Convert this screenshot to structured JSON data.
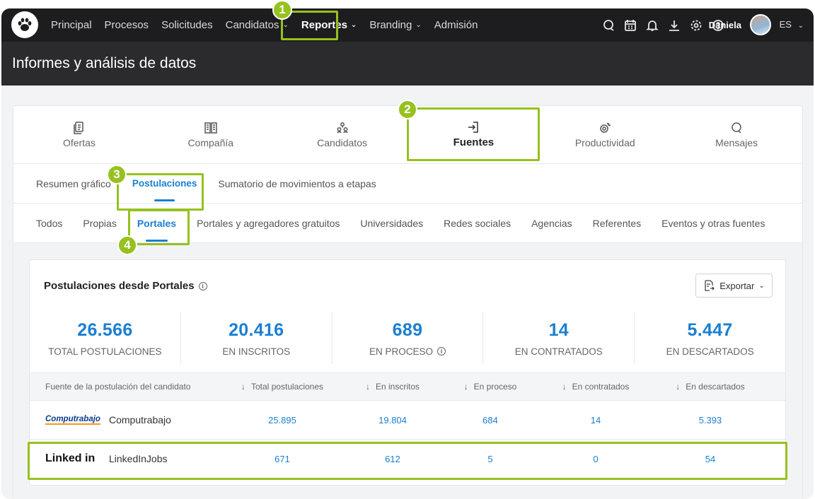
{
  "nav": {
    "items": [
      {
        "label": "Principal",
        "dropdown": false,
        "active": false
      },
      {
        "label": "Procesos",
        "dropdown": false,
        "active": false
      },
      {
        "label": "Solicitudes",
        "dropdown": false,
        "active": false
      },
      {
        "label": "Candidatos",
        "dropdown": true,
        "active": false
      },
      {
        "label": "Reportes",
        "dropdown": true,
        "active": true
      },
      {
        "label": "Branding",
        "dropdown": true,
        "active": false
      },
      {
        "label": "Admisión",
        "dropdown": false,
        "active": false
      }
    ],
    "icons": [
      "chat-icon",
      "calendar-icon",
      "bell-icon",
      "download-icon",
      "settings-icon",
      "help-icon"
    ],
    "user_name": "Daniela",
    "language": "ES"
  },
  "page": {
    "title": "Informes y análisis de datos"
  },
  "tabs": [
    {
      "label": "Ofertas",
      "icon": "document-icon",
      "active": false
    },
    {
      "label": "Compañía",
      "icon": "building-icon",
      "active": false
    },
    {
      "label": "Candidatos",
      "icon": "people-icon",
      "active": false
    },
    {
      "label": "Fuentes",
      "icon": "login-icon",
      "active": true
    },
    {
      "label": "Productividad",
      "icon": "productivity-icon",
      "active": false
    },
    {
      "label": "Mensajes",
      "icon": "message-icon",
      "active": false
    }
  ],
  "subtabs": [
    {
      "label": "Resumen gráfico",
      "active": false
    },
    {
      "label": "Postulaciones",
      "active": true
    },
    {
      "label": "Sumatorio de movimientos a etapas",
      "active": false
    }
  ],
  "filters": [
    {
      "label": "Todos",
      "active": false
    },
    {
      "label": "Propias",
      "active": false
    },
    {
      "label": "Portales",
      "active": true
    },
    {
      "label": "Portales y agregadores gratuitos",
      "active": false
    },
    {
      "label": "Universidades",
      "active": false
    },
    {
      "label": "Redes sociales",
      "active": false
    },
    {
      "label": "Agencias",
      "active": false
    },
    {
      "label": "Referentes",
      "active": false
    },
    {
      "label": "Eventos y otras fuentes",
      "active": false
    }
  ],
  "panel": {
    "title": "Postulaciones desde Portales",
    "export_label": "Exportar",
    "stats": [
      {
        "value": "26.566",
        "label": "TOTAL POSTULACIONES",
        "info": false
      },
      {
        "value": "20.416",
        "label": "EN INSCRITOS",
        "info": false
      },
      {
        "value": "689",
        "label": "EN PROCESO",
        "info": true
      },
      {
        "value": "14",
        "label": "EN CONTRATADOS",
        "info": false
      },
      {
        "value": "5.447",
        "label": "EN DESCARTADOS",
        "info": false
      }
    ],
    "table": {
      "columns": [
        "Fuente de la postulación del candidato",
        "Total postulaciones",
        "En inscritos",
        "En proceso",
        "En contratados",
        "En descartados"
      ],
      "rows": [
        {
          "logo": "Computrabajo",
          "source": "Computrabajo",
          "values": [
            "25.895",
            "19.804",
            "684",
            "14",
            "5.393"
          ]
        },
        {
          "logo": "Linked in",
          "source": "LinkedInJobs",
          "values": [
            "671",
            "612",
            "5",
            "0",
            "54"
          ]
        }
      ]
    }
  },
  "annotations": [
    "1",
    "2",
    "3",
    "4"
  ],
  "colors": {
    "accent": "#1b7fd1",
    "highlight": "#96c11f",
    "nav_bg": "#1d1d1f"
  }
}
